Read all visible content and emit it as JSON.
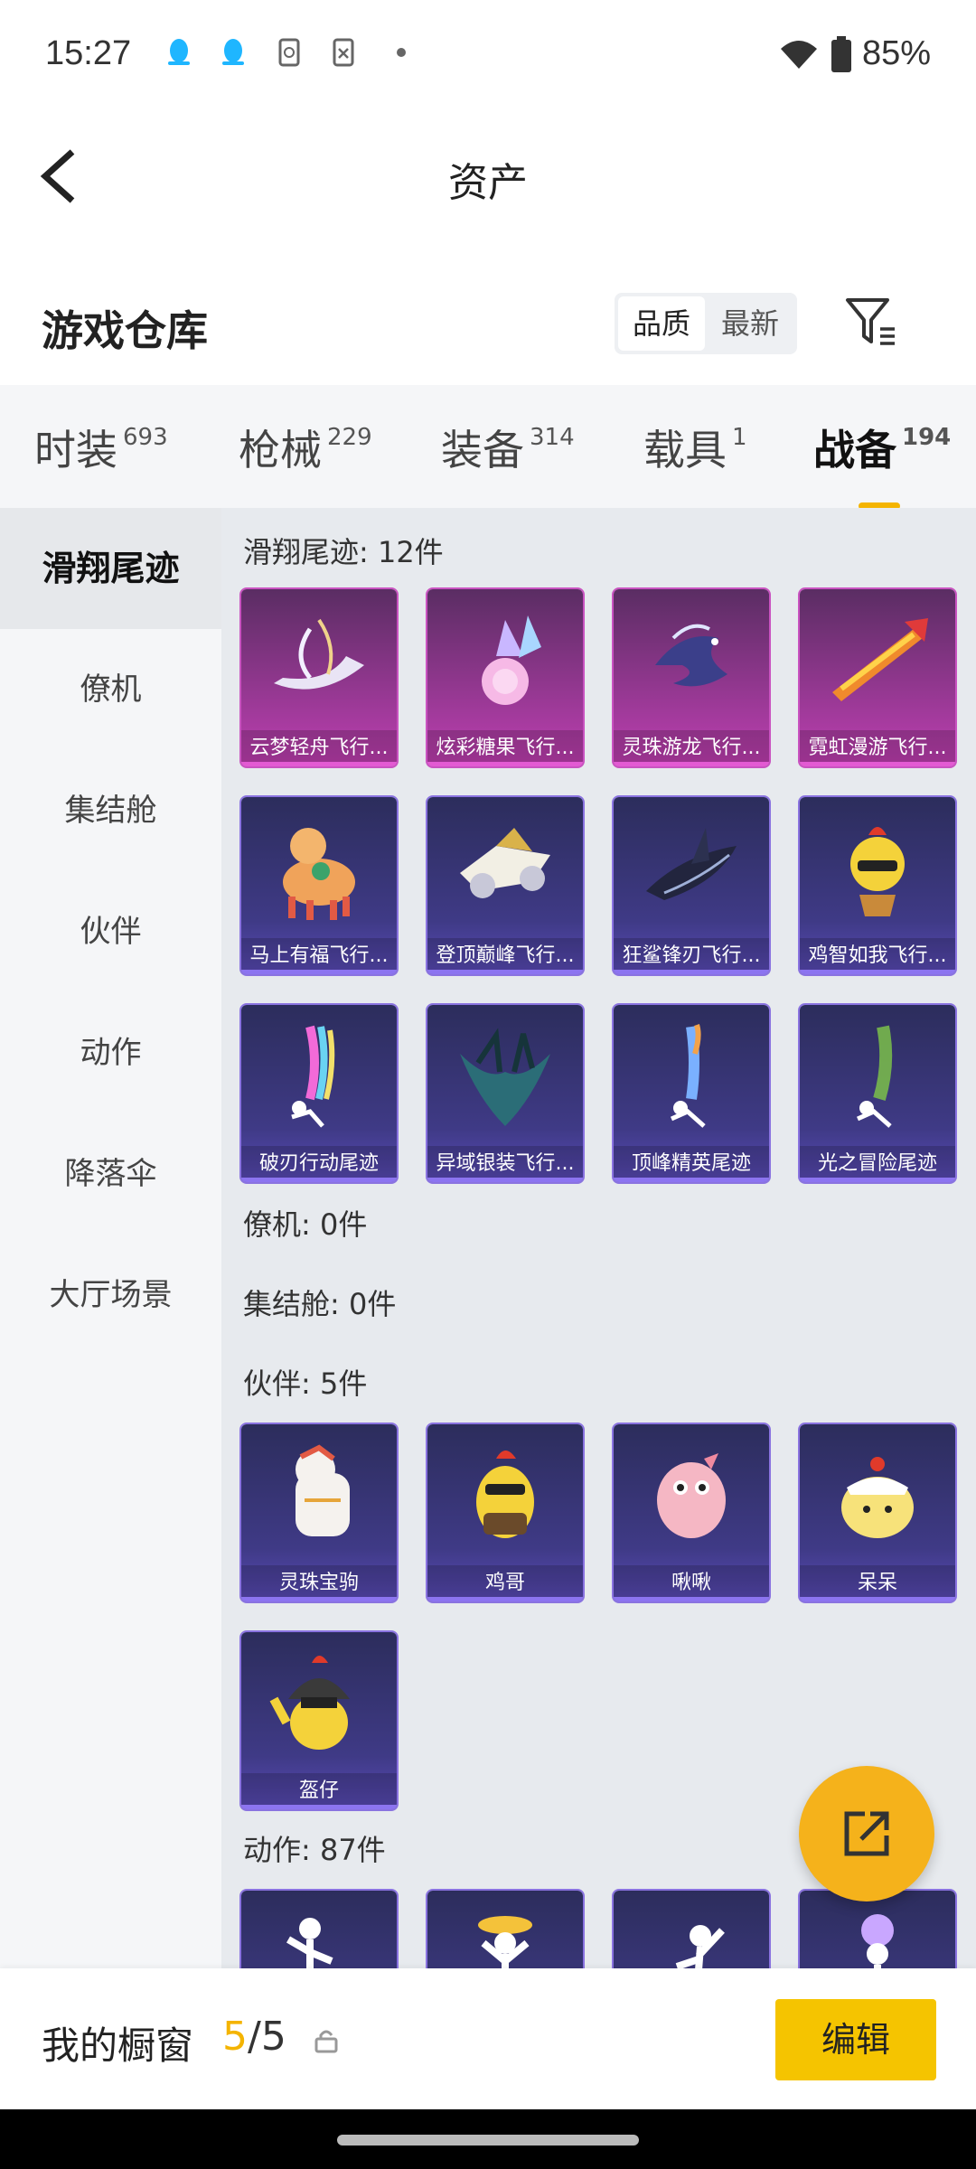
{
  "status_bar": {
    "time": "15:27",
    "battery": "85%"
  },
  "header": {
    "title": "资产"
  },
  "section": {
    "title": "游戏仓库",
    "sort_options": [
      "品质",
      "最新"
    ]
  },
  "tabs": [
    {
      "label": "时装",
      "count": "693"
    },
    {
      "label": "枪械",
      "count": "229"
    },
    {
      "label": "装备",
      "count": "314"
    },
    {
      "label": "载具",
      "count": "1"
    },
    {
      "label": "战备",
      "count": "194"
    }
  ],
  "sidebar": [
    "滑翔尾迹",
    "僚机",
    "集结舱",
    "伙伴",
    "动作",
    "降落伞",
    "大厅场景"
  ],
  "groups": {
    "trail": {
      "title": "滑翔尾迹: 12件"
    },
    "wingman": {
      "title": "僚机: 0件"
    },
    "capsule": {
      "title": "集结舱: 0件"
    },
    "partner": {
      "title": "伙伴: 5件"
    },
    "action": {
      "title": "动作: 87件"
    }
  },
  "trail_items": [
    "云梦轻舟飞行...",
    "炫彩糖果飞行...",
    "灵珠游龙飞行...",
    "霓虹漫游飞行...",
    "马上有福飞行...",
    "登顶巅峰飞行...",
    "狂鲨锋刃飞行...",
    "鸡智如我飞行...",
    "破刃行动尾迹",
    "异域银装飞行...",
    "顶峰精英尾迹",
    "光之冒险尾迹"
  ],
  "partner_items": [
    "灵珠宝驹",
    "鸡哥",
    "啾啾",
    "呆呆",
    "盔仔"
  ],
  "showcase": {
    "label": "我的橱窗",
    "current": "5",
    "total": "/5",
    "edit": "编辑"
  },
  "colors": {
    "accent": "#f4b400",
    "pink_card": "#a13a9b",
    "purple_card": "#3f3a86"
  }
}
